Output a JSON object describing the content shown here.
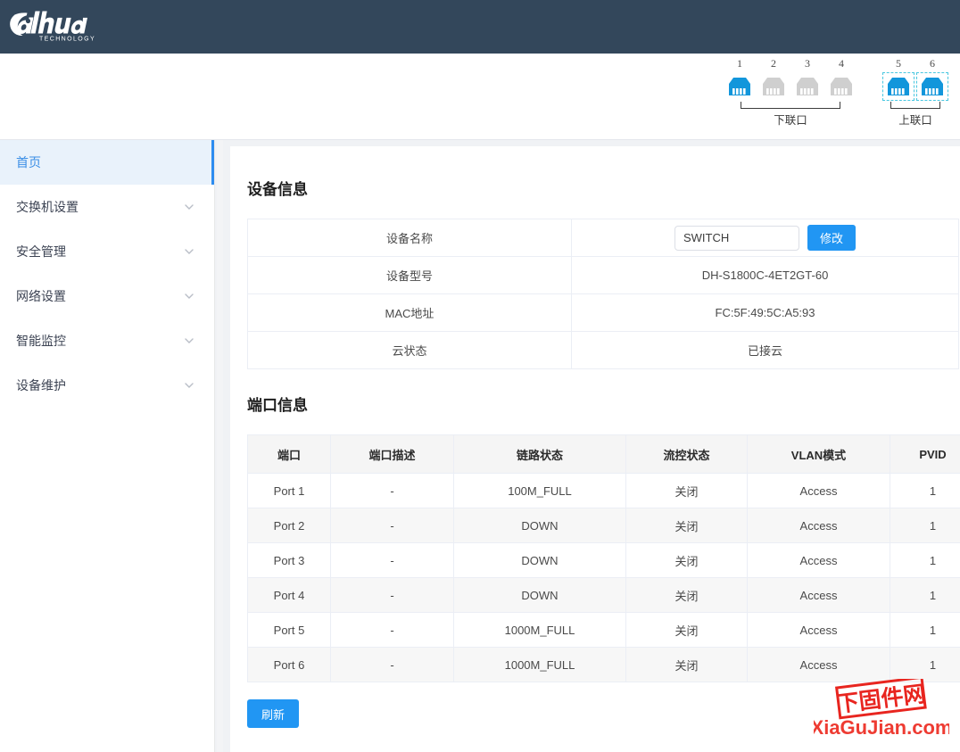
{
  "header": {
    "brand": "alhua",
    "brand_sub": "TECHNOLOGY",
    "logo_icon": "dahua-logo"
  },
  "port_panel": {
    "ports": [
      {
        "number": "1",
        "state": "active",
        "framed": false
      },
      {
        "number": "2",
        "state": "inactive",
        "framed": false
      },
      {
        "number": "3",
        "state": "inactive",
        "framed": false
      },
      {
        "number": "4",
        "state": "inactive",
        "framed": false
      },
      {
        "number": "5",
        "state": "active",
        "framed": true
      },
      {
        "number": "6",
        "state": "active",
        "framed": true
      }
    ],
    "downlink_label": "下联口",
    "uplink_label": "上联口",
    "active_color": "#1296db",
    "inactive_color": "#cfcfcf",
    "frame_color": "#49c7e0"
  },
  "sidebar": {
    "items": [
      {
        "label": "首页",
        "active": true,
        "expandable": false
      },
      {
        "label": "交换机设置",
        "active": false,
        "expandable": true
      },
      {
        "label": "安全管理",
        "active": false,
        "expandable": true
      },
      {
        "label": "网络设置",
        "active": false,
        "expandable": true
      },
      {
        "label": "智能监控",
        "active": false,
        "expandable": true
      },
      {
        "label": "设备维护",
        "active": false,
        "expandable": true
      }
    ],
    "accent_color": "#2d8cf0"
  },
  "device_info": {
    "title": "设备信息",
    "rows": [
      {
        "key": "设备名称",
        "value": "",
        "input_value": "SWITCH",
        "button_label": "修改"
      },
      {
        "key": "设备型号",
        "value": "DH-S1800C-4ET2GT-60"
      },
      {
        "key": "MAC地址",
        "value": "FC:5F:49:5C:A5:93"
      },
      {
        "key": "云状态",
        "value": "已接云"
      }
    ]
  },
  "port_info": {
    "title": "端口信息",
    "columns": [
      "端口",
      "端口描述",
      "链路状态",
      "流控状态",
      "VLAN模式",
      "PVID"
    ],
    "rows": [
      [
        "Port 1",
        "-",
        "100M_FULL",
        "关闭",
        "Access",
        "1"
      ],
      [
        "Port 2",
        "-",
        "DOWN",
        "关闭",
        "Access",
        "1"
      ],
      [
        "Port 3",
        "-",
        "DOWN",
        "关闭",
        "Access",
        "1"
      ],
      [
        "Port 4",
        "-",
        "DOWN",
        "关闭",
        "Access",
        "1"
      ],
      [
        "Port 5",
        "-",
        "1000M_FULL",
        "关闭",
        "Access",
        "1"
      ],
      [
        "Port 6",
        "-",
        "1000M_FULL",
        "关闭",
        "Access",
        "1"
      ]
    ],
    "refresh_label": "刷新"
  },
  "watermark": {
    "top_text": "下固件网",
    "bottom_text": "XiaGuJian.com",
    "color": "#e8251f"
  }
}
